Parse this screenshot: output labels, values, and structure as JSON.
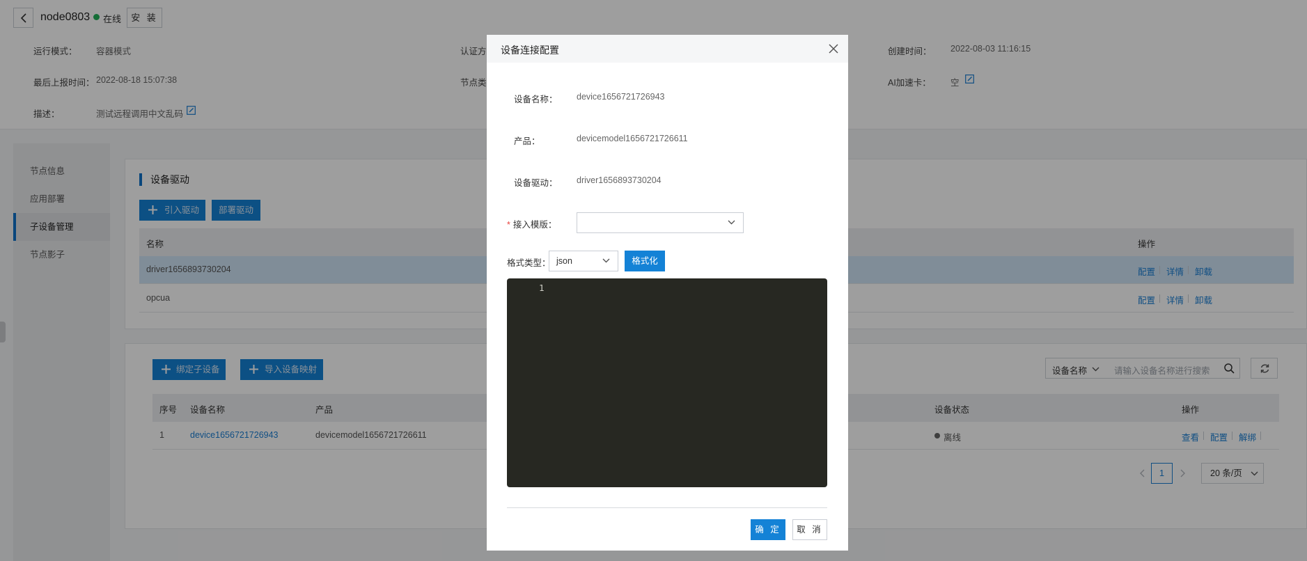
{
  "header": {
    "node_name": "node0803",
    "status": "在线",
    "install_label": "安 装",
    "fields": {
      "run_mode_label": "运行模式：",
      "run_mode_value": "容器模式",
      "auth_label": "认证方",
      "created_label": "创建时间：",
      "created_value": "2022-08-03 11:16:15",
      "last_report_label": "最后上报时间：",
      "last_report_value": "2022-08-18 15:07:38",
      "node_type_label": "节点类",
      "ai_card_label": "AI加速卡：",
      "ai_card_value": "空",
      "desc_label": "描述：",
      "desc_value": "测试远程调用中文乱码"
    }
  },
  "sidebar": {
    "items": [
      {
        "label": "节点信息"
      },
      {
        "label": "应用部署"
      },
      {
        "label": "子设备管理"
      },
      {
        "label": "节点影子"
      }
    ]
  },
  "drivers": {
    "title": "设备驱动",
    "import_label": "引入驱动",
    "deploy_label": "部署驱动",
    "columns": {
      "name": "名称",
      "ops": "操作"
    },
    "rows": [
      {
        "name": "driver1656893730204",
        "op1": "配置",
        "op2": "详情",
        "op3": "卸载"
      },
      {
        "name": "opcua",
        "op1": "配置",
        "op2": "详情",
        "op3": "卸载"
      }
    ]
  },
  "subdevices": {
    "bind_label": "绑定子设备",
    "import_map_label": "导入设备映射",
    "search_field": "设备名称",
    "search_placeholder": "请输入设备名称进行搜索",
    "columns": {
      "no": "序号",
      "name": "设备名称",
      "product": "产品",
      "status": "设备状态",
      "ops": "操作"
    },
    "rows": [
      {
        "no": "1",
        "name": "device1656721726943",
        "product": "devicemodel1656721726611",
        "status": "离线",
        "op1": "查看",
        "op2": "配置",
        "op3": "解绑"
      }
    ],
    "page": "1",
    "page_size": "20 条/页"
  },
  "modal": {
    "title": "设备连接配置",
    "device_name_label": "设备名称：",
    "device_name_value": "device1656721726943",
    "product_label": "产品：",
    "product_value": "devicemodel1656721726611",
    "driver_label": "设备驱动：",
    "driver_value": "driver1656893730204",
    "template_label": "接入模版：",
    "template_required": "*",
    "template_value": "",
    "format_type_label": "格式类型：",
    "format_type_value": "json",
    "format_button": "格式化",
    "editor_line": "1",
    "ok_label": "确 定",
    "cancel_label": "取 消"
  }
}
